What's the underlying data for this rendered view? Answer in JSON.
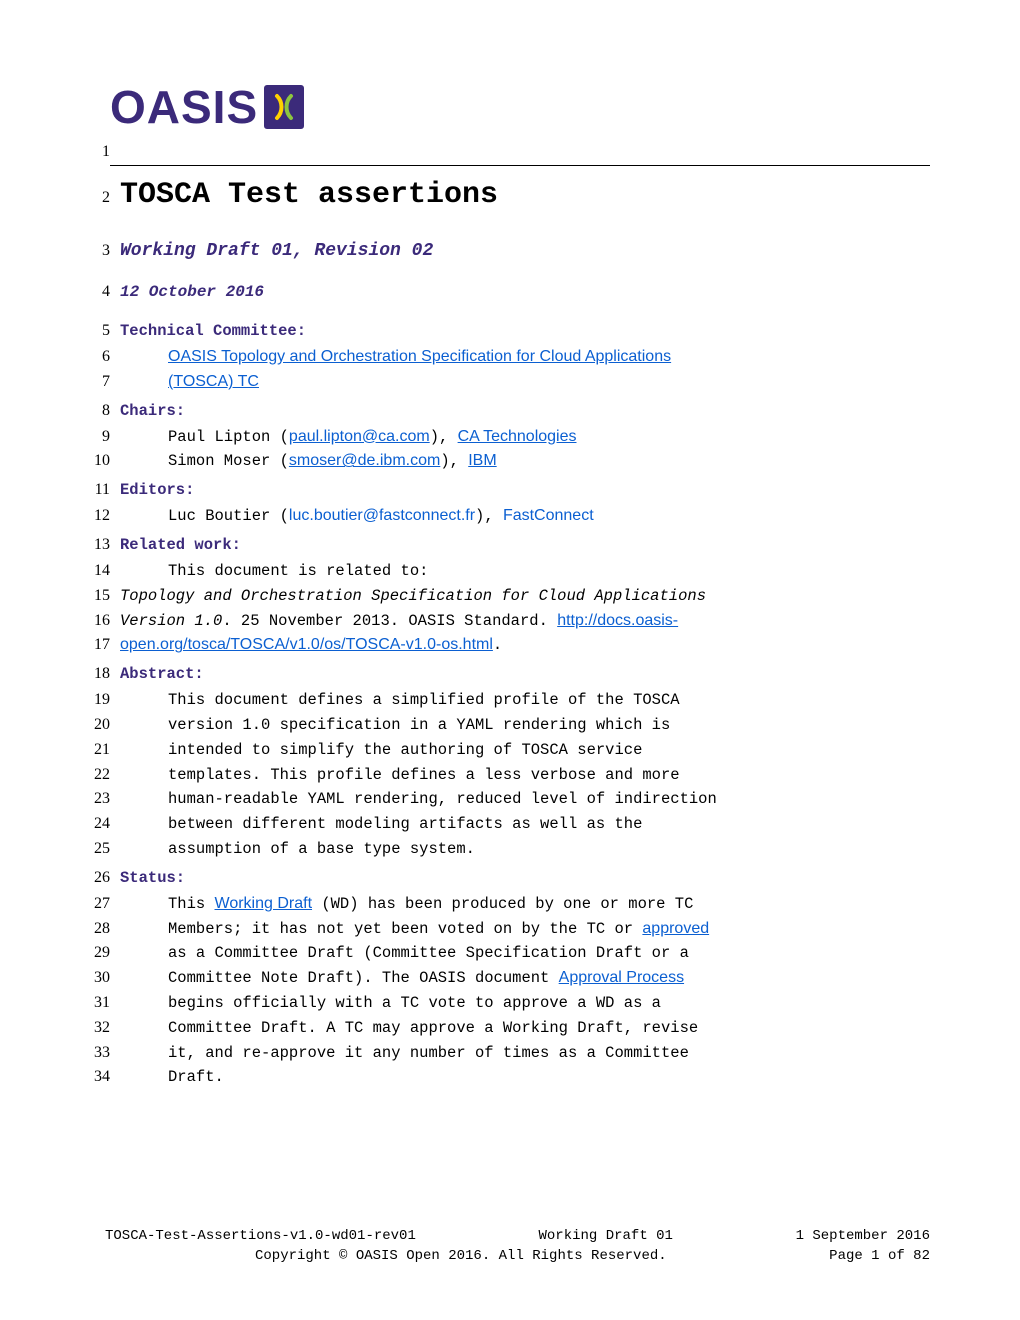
{
  "logo": {
    "text": "OASIS"
  },
  "title": "TOSCA Test assertions",
  "subtitle": "Working Draft 01, Revision 02",
  "date": "12 October 2016",
  "tc": {
    "heading": "Technical Committee:",
    "link_l1": "OASIS Topology and Orchestration Specification for Cloud Applications",
    "link_l2": "(TOSCA) TC"
  },
  "chairs": {
    "heading": "Chairs:",
    "c1_name": "Paul Lipton (",
    "c1_email": "paul.lipton@ca.com",
    "c1_mid": "), ",
    "c1_org": "CA Technologies",
    "c2_name": "Simon Moser (",
    "c2_email": "smoser@de.ibm.com",
    "c2_mid": "), ",
    "c2_org": "IBM"
  },
  "editors": {
    "heading": "Editors:",
    "e1_name": "Luc Boutier (",
    "e1_email": "luc.boutier@fastconnect.fr",
    "e1_mid": "), ",
    "e1_org": "FastConnect"
  },
  "related": {
    "heading": "Related work:",
    "intro": "This document is related to:",
    "l1": "Topology and Orchestration Specification for Cloud Applications",
    "l2a": "Version 1.0",
    "l2b": ". 25 November 2013. OASIS Standard. ",
    "l2c": "http://docs.oasis-",
    "l3a": "open.org/tosca/TOSCA/v1.0/os/TOSCA-v1.0-os.html",
    "l3b": "."
  },
  "abstract": {
    "heading": "Abstract:",
    "p": [
      "This document defines a simplified profile of the TOSCA",
      "version 1.0 specification in a YAML rendering which is",
      "intended to simplify the authoring of TOSCA service",
      "templates.  This profile defines a less verbose and more",
      "human-readable YAML rendering, reduced level of indirection",
      "between different modeling artifacts as well as the",
      "assumption of a base type system."
    ]
  },
  "status": {
    "heading": "Status:",
    "s1a": "This ",
    "s1b": "Working Draft",
    "s1c": " (WD) has been produced by one or more TC",
    "s2a": "Members; it has not yet been voted on by the TC or ",
    "s2b": "approved",
    "s3": "as a Committee Draft (Committee Specification Draft or a",
    "s4a": "Committee Note Draft). The OASIS document ",
    "s4b": "Approval Process",
    "s5": "begins officially with a TC vote to approve a WD as a",
    "s6": "Committee Draft. A TC may approve a Working Draft, revise",
    "s7": "it, and re-approve it any number of times as a Committee",
    "s8": "Draft."
  },
  "footer": {
    "left": "TOSCA-Test-Assertions-v1.0-wd01-rev01",
    "center": "Working Draft 01",
    "right": "1 September 2016",
    "copy": "Copyright © OASIS Open 2016. All Rights Reserved.",
    "page": "Page 1 of 82"
  },
  "linenums": {
    "n1": "1",
    "n2": "2",
    "n3": "3",
    "n4": "4",
    "n5": "5",
    "n6": "6",
    "n7": "7",
    "n8": "8",
    "n9": "9",
    "n10": "10",
    "n11": "11",
    "n12": "12",
    "n13": "13",
    "n14": "14",
    "n15": "15",
    "n16": "16",
    "n17": "17",
    "n18": "18",
    "n19": "19",
    "n20": "20",
    "n21": "21",
    "n22": "22",
    "n23": "23",
    "n24": "24",
    "n25": "25",
    "n26": "26",
    "n27": "27",
    "n28": "28",
    "n29": "29",
    "n30": "30",
    "n31": "31",
    "n32": "32",
    "n33": "33",
    "n34": "34"
  }
}
